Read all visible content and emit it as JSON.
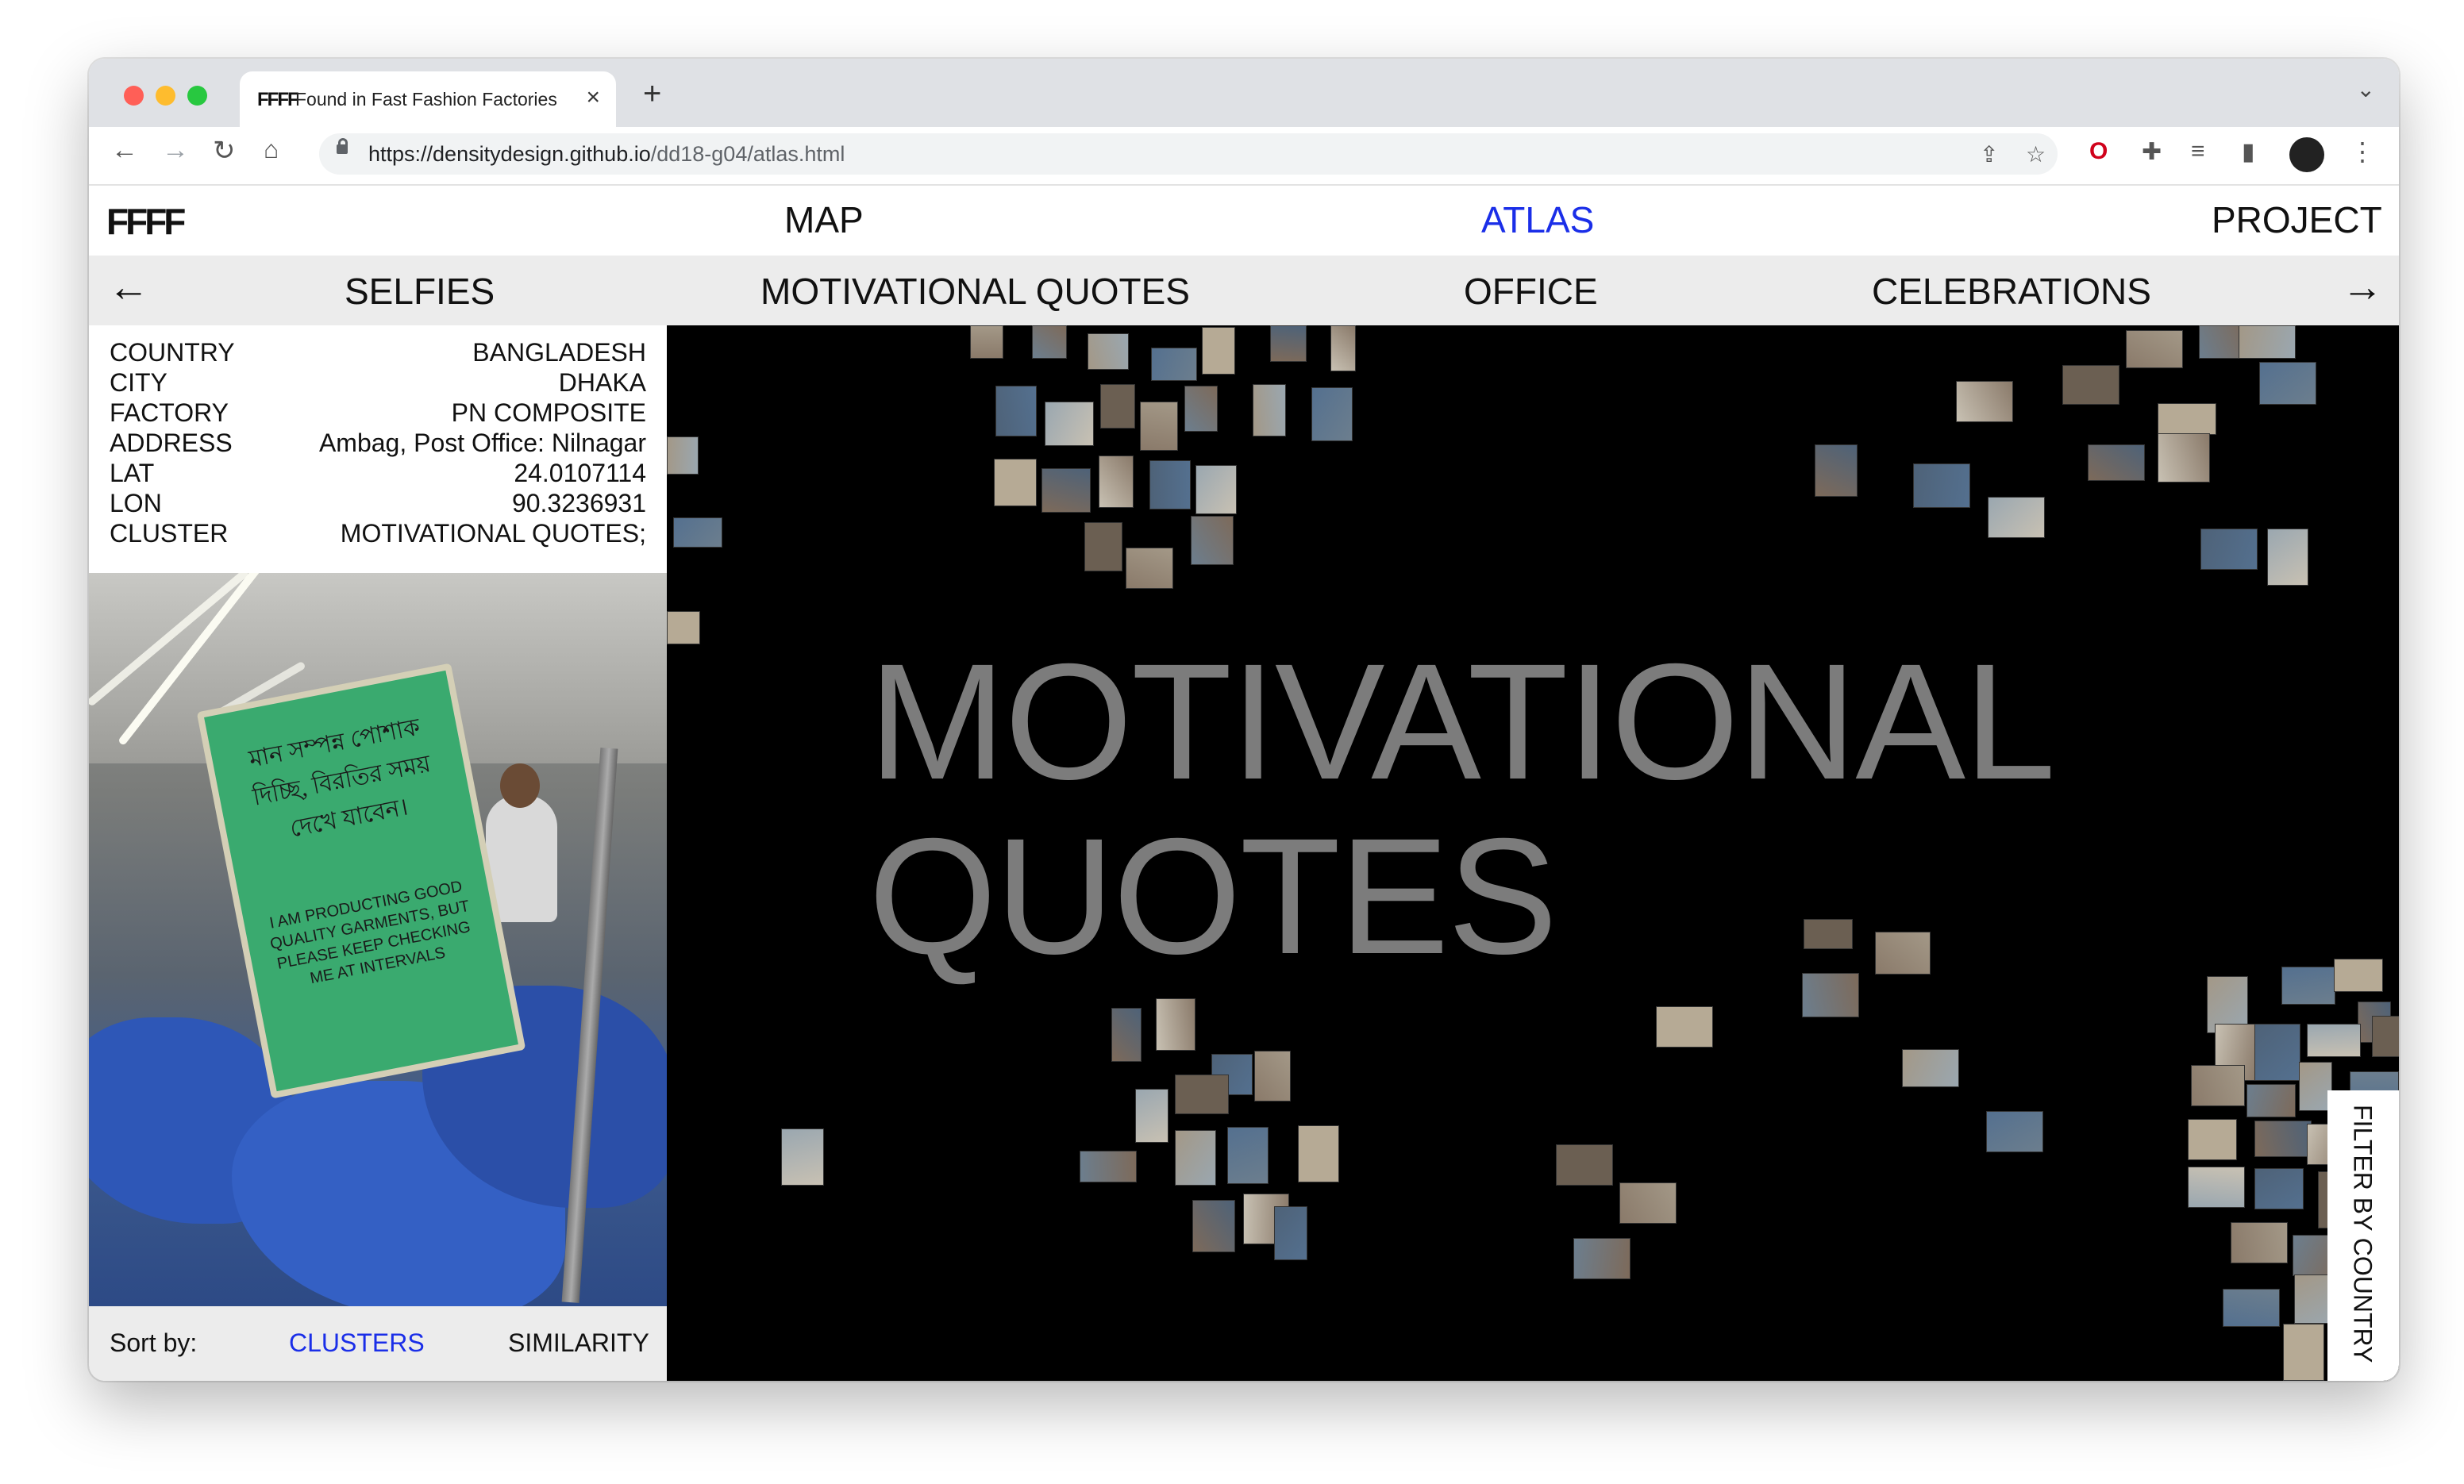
{
  "browser": {
    "tab_title": "Found in Fast Fashion Factories",
    "tab_favicon": "FFFF",
    "url_host": "https://densitydesign.github.io",
    "url_path": "/dd18-g04/atlas.html",
    "icons": [
      "back-icon",
      "forward-icon",
      "reload-icon",
      "home-icon",
      "lock-icon",
      "share-icon",
      "star-icon",
      "opera-icon",
      "extensions-icon",
      "media-icon",
      "sidepanel-icon",
      "profile-icon",
      "menu-icon"
    ]
  },
  "nav": {
    "logo": "FFFF",
    "items": [
      "MAP",
      "ATLAS",
      "PROJECT"
    ],
    "active": "ATLAS"
  },
  "clusters": {
    "prev_icon": "arrow-left-icon",
    "next_icon": "arrow-right-icon",
    "items": [
      "SELFIES",
      "MOTIVATIONAL QUOTES",
      "OFFICE",
      "CELEBRATIONS"
    ]
  },
  "details": {
    "rows": [
      {
        "key": "COUNTRY",
        "value": "BANGLADESH"
      },
      {
        "key": "CITY",
        "value": "DHAKA"
      },
      {
        "key": "FACTORY",
        "value": "PN COMPOSITE"
      },
      {
        "key": "ADDRESS",
        "value": "Ambag, Post Office: Nilnagar"
      },
      {
        "key": "LAT",
        "value": "24.0107114"
      },
      {
        "key": "LON",
        "value": "90.3236931"
      },
      {
        "key": "CLUSTER",
        "value": "MOTIVATIONAL QUOTES;"
      }
    ],
    "photo_sign_bn": "মান সম্পন্ন পোশাক দিচ্ছি, বিরতির সময় দেখে যাবেন।",
    "photo_sign_en": "I AM PRODUCTING GOOD QUALITY GARMENTS, BUT PLEASE KEEP CHECKING ME AT INTERVALS"
  },
  "sort": {
    "label": "Sort by:",
    "options": [
      "CLUSTERS",
      "SIMILARITY"
    ],
    "active": "CLUSTERS"
  },
  "atlas": {
    "title_line1": "MOTIVATIONAL",
    "title_line2": "QUOTES",
    "filter_label": "FILTER BY COUNTRY"
  }
}
